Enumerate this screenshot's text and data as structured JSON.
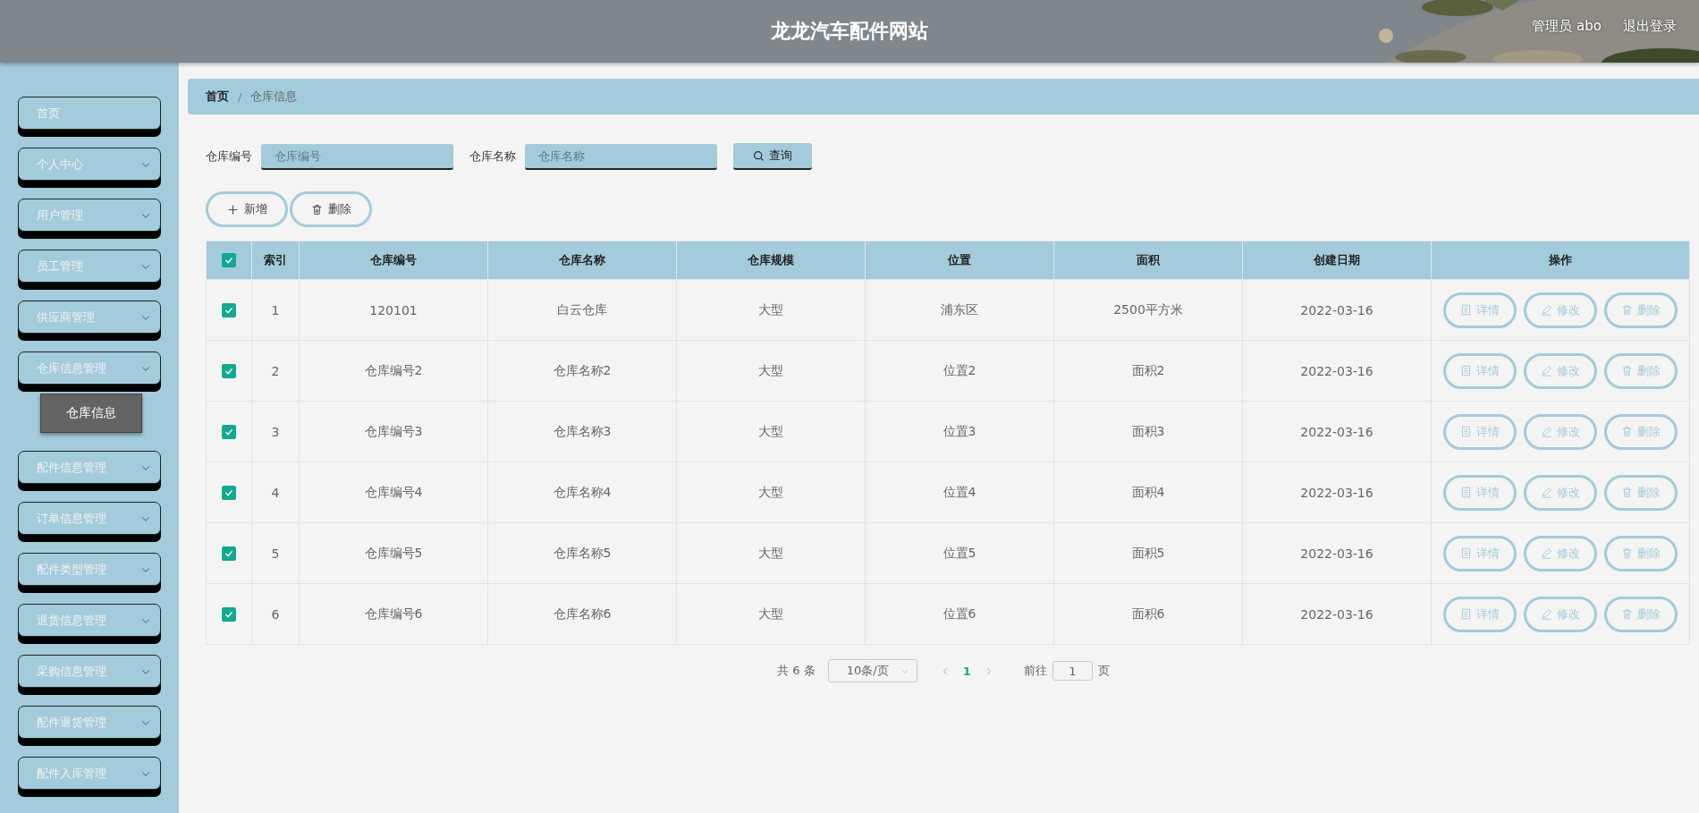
{
  "header": {
    "title": "龙龙汽车配件网站",
    "user": "管理员 abo",
    "logout": "退出登录"
  },
  "sidebar": {
    "items": [
      {
        "kind": "link",
        "label": "首页"
      },
      {
        "kind": "menu",
        "label": "个人中心"
      },
      {
        "kind": "menu",
        "label": "用户管理"
      },
      {
        "kind": "menu",
        "label": "员工管理"
      },
      {
        "kind": "menu",
        "label": "供应商管理"
      },
      {
        "kind": "menu",
        "label": "仓库信息管理",
        "children": [
          {
            "label": "仓库信息",
            "selected": true
          }
        ]
      },
      {
        "kind": "menu",
        "label": "配件信息管理"
      },
      {
        "kind": "menu",
        "label": "订单信息管理"
      },
      {
        "kind": "menu",
        "label": "配件类型管理"
      },
      {
        "kind": "menu",
        "label": "退货信息管理"
      },
      {
        "kind": "menu",
        "label": "采购信息管理"
      },
      {
        "kind": "menu",
        "label": "配件退货管理"
      },
      {
        "kind": "menu",
        "label": "配件入库管理"
      }
    ]
  },
  "breadcrumb": {
    "separator": "/",
    "items": [
      "首页",
      "仓库信息"
    ]
  },
  "search": {
    "fields": [
      {
        "label": "仓库编号",
        "placeholder": "仓库编号"
      },
      {
        "label": "仓库名称",
        "placeholder": "仓库名称"
      }
    ],
    "button": "查询"
  },
  "actions": [
    {
      "kind": "add",
      "label": "新增"
    },
    {
      "kind": "delete",
      "label": "删除"
    }
  ],
  "table": {
    "all_checked": true,
    "columns": [
      "索引",
      "仓库编号",
      "仓库名称",
      "仓库规模",
      "位置",
      "面积",
      "创建日期",
      "操作"
    ],
    "rows": [
      {
        "checked": true,
        "cells": [
          "1",
          "120101",
          "白云仓库",
          "大型",
          "浦东区",
          "2500平方米",
          "2022-03-16"
        ],
        "buttons": [
          {
            "kind": "detail",
            "label": "详情"
          },
          {
            "kind": "edit",
            "label": "修改"
          },
          {
            "kind": "delete",
            "label": "删除"
          }
        ]
      },
      {
        "checked": true,
        "cells": [
          "2",
          "仓库编号2",
          "仓库名称2",
          "大型",
          "位置2",
          "面积2",
          "2022-03-16"
        ],
        "buttons": [
          {
            "kind": "detail",
            "label": "详情"
          },
          {
            "kind": "edit",
            "label": "修改"
          },
          {
            "kind": "delete",
            "label": "删除"
          }
        ]
      },
      {
        "checked": true,
        "cells": [
          "3",
          "仓库编号3",
          "仓库名称3",
          "大型",
          "位置3",
          "面积3",
          "2022-03-16"
        ],
        "buttons": [
          {
            "kind": "detail",
            "label": "详情"
          },
          {
            "kind": "edit",
            "label": "修改"
          },
          {
            "kind": "delete",
            "label": "删除"
          }
        ]
      },
      {
        "checked": true,
        "cells": [
          "4",
          "仓库编号4",
          "仓库名称4",
          "大型",
          "位置4",
          "面积4",
          "2022-03-16"
        ],
        "buttons": [
          {
            "kind": "detail",
            "label": "详情"
          },
          {
            "kind": "edit",
            "label": "修改"
          },
          {
            "kind": "delete",
            "label": "删除"
          }
        ]
      },
      {
        "checked": true,
        "cells": [
          "5",
          "仓库编号5",
          "仓库名称5",
          "大型",
          "位置5",
          "面积5",
          "2022-03-16"
        ],
        "buttons": [
          {
            "kind": "detail",
            "label": "详情"
          },
          {
            "kind": "edit",
            "label": "修改"
          },
          {
            "kind": "delete",
            "label": "删除"
          }
        ]
      },
      {
        "checked": true,
        "cells": [
          "6",
          "仓库编号6",
          "仓库名称6",
          "大型",
          "位置6",
          "面积6",
          "2022-03-16"
        ],
        "buttons": [
          {
            "kind": "detail",
            "label": "详情"
          },
          {
            "kind": "edit",
            "label": "修改"
          },
          {
            "kind": "delete",
            "label": "删除"
          }
        ]
      }
    ]
  },
  "pagination": {
    "total": "共 6 条",
    "page_size": "10条/页",
    "pages": [
      {
        "label": "1",
        "selected": true
      }
    ],
    "goto_label": "前往",
    "goto_value": "1",
    "page_suffix": "页"
  }
}
